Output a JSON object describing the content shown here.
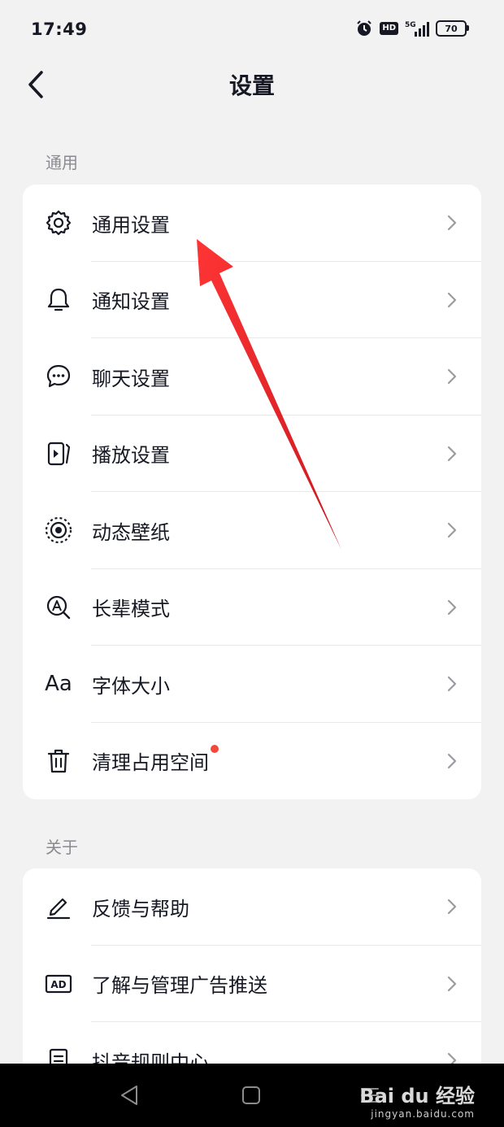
{
  "status_bar": {
    "time": "17:49",
    "hd": "HD",
    "network": "5G",
    "battery": "70"
  },
  "header": {
    "title": "设置"
  },
  "sections": [
    {
      "label": "通用",
      "items": [
        {
          "label": "通用设置",
          "icon": "gear-icon"
        },
        {
          "label": "通知设置",
          "icon": "bell-icon"
        },
        {
          "label": "聊天设置",
          "icon": "chat-bubble-icon"
        },
        {
          "label": "播放设置",
          "icon": "play-settings-icon"
        },
        {
          "label": "动态壁纸",
          "icon": "live-wallpaper-icon"
        },
        {
          "label": "长辈模式",
          "icon": "elder-mode-icon"
        },
        {
          "label": "字体大小",
          "icon": "font-size-icon",
          "icon_text": "Aa"
        },
        {
          "label": "清理占用空间",
          "icon": "trash-icon",
          "badge": "red-dot"
        }
      ]
    },
    {
      "label": "关于",
      "items": [
        {
          "label": "反馈与帮助",
          "icon": "edit-icon"
        },
        {
          "label": "了解与管理广告推送",
          "icon": "ad-icon",
          "icon_text": "AD"
        },
        {
          "label": "抖音规则中心",
          "icon": "document-icon"
        }
      ]
    }
  ],
  "watermark": {
    "brand": "Bai du 经验",
    "url": "jingyan.baidu.com"
  },
  "colors": {
    "background": "#f2f2f2",
    "card": "#ffffff",
    "badge": "#f24a3a",
    "arrow": "#e8181f"
  }
}
